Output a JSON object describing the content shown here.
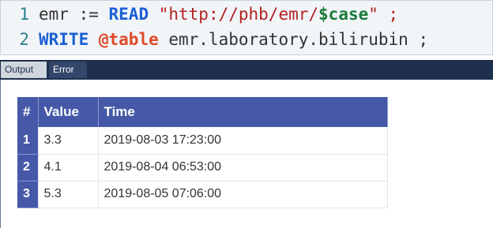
{
  "editor": {
    "lines": [
      {
        "num": "1",
        "tokens": {
          "a": "emr := ",
          "b": "READ",
          "c": " \"http://phb/emr/",
          "d": "$case",
          "e": "\" ;"
        }
      },
      {
        "num": "2",
        "tokens": {
          "a": "WRITE",
          "b": " ",
          "c": "@table",
          "d": " emr.laboratory.bilirubin ;"
        }
      }
    ]
  },
  "tabs": {
    "output": "Output",
    "error": "Error"
  },
  "table": {
    "headers": [
      "#",
      "Value",
      "Time"
    ],
    "rows": [
      {
        "index": "1",
        "value": "3.3",
        "time": "2019-08-03 17:23:00"
      },
      {
        "index": "2",
        "value": "4.1",
        "time": "2019-08-04 06:53:00"
      },
      {
        "index": "3",
        "value": "5.3",
        "time": "2019-08-05 07:06:00"
      }
    ]
  }
}
